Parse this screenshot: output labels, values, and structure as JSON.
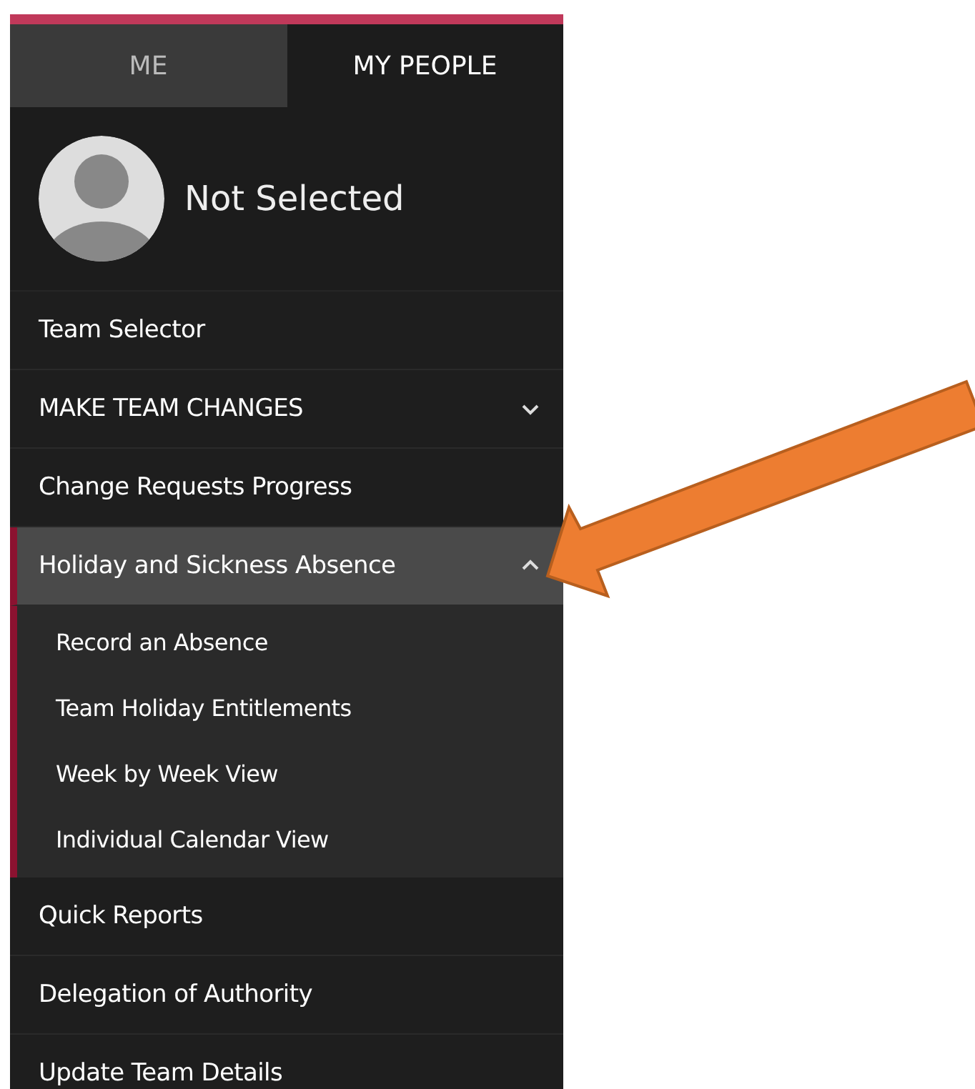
{
  "tabs": [
    {
      "label": "ME",
      "selected": false
    },
    {
      "label": "MY PEOPLE",
      "selected": true
    }
  ],
  "profile": {
    "name": "Not Selected"
  },
  "menu": [
    {
      "label": "Team Selector",
      "selected": false
    },
    {
      "label": "MAKE TEAM CHANGES",
      "selected": false,
      "expanded": false
    },
    {
      "label": "Change Requests Progress",
      "selected": false
    },
    {
      "label": "Holiday and Sickness Absence",
      "selected": true,
      "expanded": true,
      "children": [
        {
          "label": "Record an Absence"
        },
        {
          "label": "Team Holiday Entitlements"
        },
        {
          "label": "Week by Week View"
        },
        {
          "label": "Individual Calendar View"
        }
      ]
    },
    {
      "label": "Quick Reports",
      "selected": false
    },
    {
      "label": "Delegation of Authority",
      "selected": false
    },
    {
      "label": "Update Team Details",
      "selected": false
    }
  ]
}
